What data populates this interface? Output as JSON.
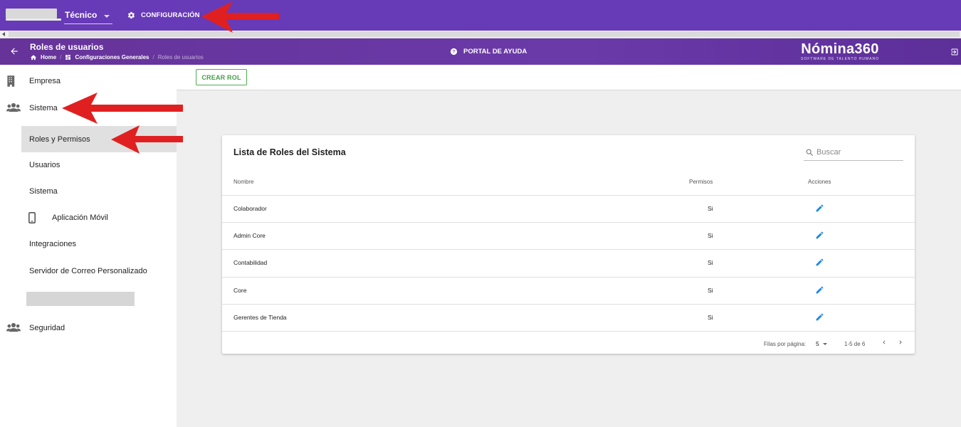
{
  "topbar": {
    "tech_label": "Técnico",
    "config_label": "CONFIGURACIÓN"
  },
  "navbar": {
    "title": "Roles de usuarios",
    "breadcrumb": {
      "home": "Home",
      "general": "Configuraciones Generales",
      "current": "Roles de usuarios"
    },
    "help_label": "PORTAL DE AYUDA",
    "brand_name": "Nómina360",
    "brand_tagline": "SOFTWARE DE TALENTO HUMANO"
  },
  "sidebar": {
    "empresa": "Empresa",
    "sistema": "Sistema",
    "sub_items": [
      {
        "label": "Roles y Permisos",
        "active": true
      },
      {
        "label": "Usuarios"
      },
      {
        "label": "Sistema"
      },
      {
        "label": "Aplicación Móvil"
      },
      {
        "label": "Integraciones"
      },
      {
        "label": "Servidor de Correo Personalizado"
      }
    ],
    "seguridad": "Seguridad"
  },
  "toolbar": {
    "create_label": "CREAR ROL"
  },
  "card": {
    "title": "Lista de Roles del Sistema",
    "search_placeholder": "Buscar",
    "headers": {
      "name": "Nombre",
      "permissions": "Permisos",
      "actions": "Acciones"
    },
    "rows": [
      {
        "name": "Colaborador",
        "perm": "Si"
      },
      {
        "name": "Admin Core",
        "perm": "Si"
      },
      {
        "name": "Contabilidad",
        "perm": "Si"
      },
      {
        "name": "Core",
        "perm": "Si"
      },
      {
        "name": "Gerentes de Tienda",
        "perm": "Si"
      }
    ],
    "footer": {
      "rows_per_page_label": "Filas por página:",
      "rows_per_page": "5",
      "range": "1-5 de 6"
    }
  },
  "colors": {
    "primary": "#673ab7",
    "accent_green": "#43a047",
    "edit_blue": "#1e88e5",
    "annotation_red": "#e02020"
  }
}
